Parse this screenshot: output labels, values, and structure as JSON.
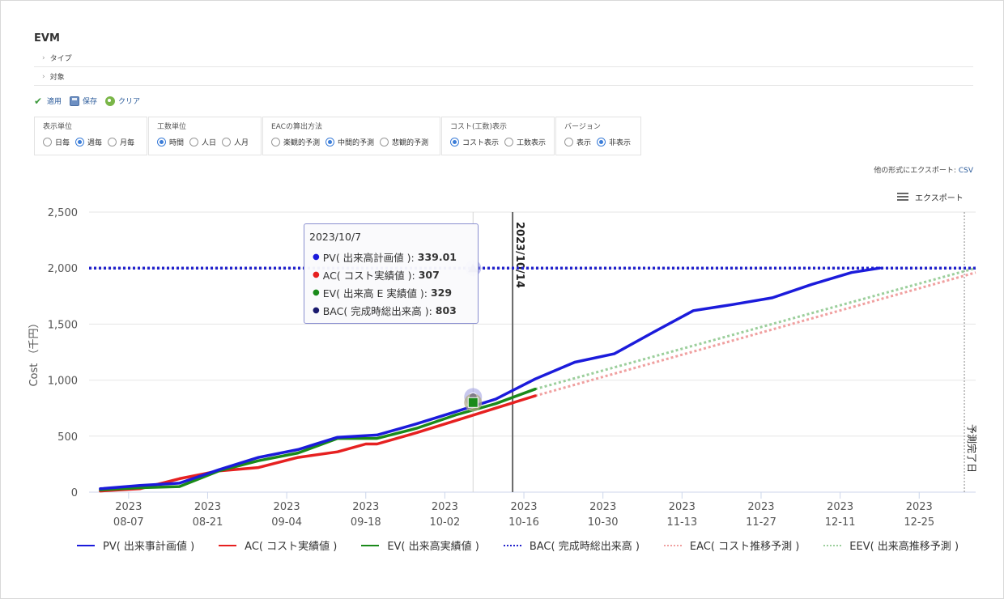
{
  "app": {
    "title": "EVM"
  },
  "sections": [
    {
      "label": "タイプ"
    },
    {
      "label": "対象"
    }
  ],
  "toolbar": {
    "apply_label": "適用",
    "save_label": "保存",
    "clear_label": "クリア"
  },
  "options": {
    "display_unit": {
      "label": "表示単位",
      "choices": [
        "日毎",
        "週毎",
        "月毎"
      ],
      "selected": "週毎"
    },
    "work_unit": {
      "label": "工数単位",
      "choices": [
        "時間",
        "人日",
        "人月"
      ],
      "selected": "時間"
    },
    "eac_method": {
      "label": "EACの算出方法",
      "choices": [
        "楽観的予測",
        "中間的予測",
        "悲観的予測"
      ],
      "selected": "中間的予測"
    },
    "cost_display": {
      "label": "コスト(工数)表示",
      "choices": [
        "コスト表示",
        "工数表示"
      ],
      "selected": "コスト表示"
    },
    "version": {
      "label": "バージョン",
      "choices": [
        "表示",
        "非表示"
      ],
      "selected": "非表示"
    }
  },
  "export": {
    "other_formats_label": "他の形式にエクスポート:",
    "csv_label": "CSV",
    "menu_label": "エクスポート"
  },
  "tooltip": {
    "date": "2023/10/7",
    "rows": [
      {
        "label": "PV( 出来高計画値 ):",
        "value": "339.01",
        "color": "#1b1bdb"
      },
      {
        "label": "AC( コスト実績値 ):",
        "value": "307",
        "color": "#e62020"
      },
      {
        "label": "EV( 出来高 E 実績値 ):",
        "value": "329",
        "color": "#1a8a1a"
      },
      {
        "label": "BAC( 完成時総出来高 ):",
        "value": "803",
        "color": "#1a1a6e"
      }
    ]
  },
  "chart_data": {
    "type": "line",
    "ylabel": "Cost （千円）",
    "ylim": [
      0,
      2500
    ],
    "yticks": [
      0,
      500,
      1000,
      1500,
      2000,
      2500
    ],
    "ytick_labels": [
      "0",
      "500",
      "1,000",
      "1,500",
      "2,000",
      "2,500"
    ],
    "xlim": [
      "2023-07-31",
      "2024-01-04"
    ],
    "xticks": [
      {
        "date": "2023-08-07",
        "label": [
          "2023",
          "08-07"
        ]
      },
      {
        "date": "2023-08-21",
        "label": [
          "2023",
          "08-21"
        ]
      },
      {
        "date": "2023-09-04",
        "label": [
          "2023",
          "09-04"
        ]
      },
      {
        "date": "2023-09-18",
        "label": [
          "2023",
          "09-18"
        ]
      },
      {
        "date": "2023-10-02",
        "label": [
          "2023",
          "10-02"
        ]
      },
      {
        "date": "2023-10-16",
        "label": [
          "2023",
          "10-16"
        ]
      },
      {
        "date": "2023-10-30",
        "label": [
          "2023",
          "10-30"
        ]
      },
      {
        "date": "2023-11-13",
        "label": [
          "2023",
          "11-13"
        ]
      },
      {
        "date": "2023-11-27",
        "label": [
          "2023",
          "11-27"
        ]
      },
      {
        "date": "2023-12-11",
        "label": [
          "2023",
          "12-11"
        ]
      },
      {
        "date": "2023-12-25",
        "label": [
          "2023",
          "12-25"
        ]
      }
    ],
    "grid": true,
    "legend_position": "bottom",
    "plot_lines": [
      {
        "date": "2023-10-14",
        "label": "2023/10/14",
        "color": "#666666"
      },
      {
        "date": "2024-01-02",
        "label": "予測完了日",
        "color": "#888888"
      }
    ],
    "hover_date": "2023-10-07",
    "series": [
      {
        "name": "PV( 出来事計画値 )",
        "color": "#1b1bdb",
        "style": "solid",
        "points": [
          [
            "2023-08-02",
            30
          ],
          [
            "2023-08-09",
            60
          ],
          [
            "2023-08-16",
            80
          ],
          [
            "2023-08-23",
            200
          ],
          [
            "2023-08-30",
            310
          ],
          [
            "2023-09-06",
            380
          ],
          [
            "2023-09-13",
            490
          ],
          [
            "2023-09-20",
            510
          ],
          [
            "2023-09-27",
            610
          ],
          [
            "2023-10-04",
            720
          ],
          [
            "2023-10-11",
            830
          ],
          [
            "2023-10-18",
            1010
          ],
          [
            "2023-10-25",
            1160
          ],
          [
            "2023-11-01",
            1235
          ],
          [
            "2023-11-08",
            1430
          ],
          [
            "2023-11-15",
            1620
          ],
          [
            "2023-11-22",
            1675
          ],
          [
            "2023-11-29",
            1735
          ],
          [
            "2023-12-06",
            1855
          ],
          [
            "2023-12-13",
            1960
          ],
          [
            "2023-12-18",
            2000
          ]
        ]
      },
      {
        "name": "AC( コスト実績値 )",
        "color": "#e62020",
        "style": "solid",
        "points": [
          [
            "2023-08-02",
            10
          ],
          [
            "2023-08-09",
            30
          ],
          [
            "2023-08-16",
            120
          ],
          [
            "2023-08-23",
            190
          ],
          [
            "2023-08-30",
            220
          ],
          [
            "2023-09-06",
            310
          ],
          [
            "2023-09-13",
            360
          ],
          [
            "2023-09-18",
            430
          ],
          [
            "2023-09-20",
            430
          ],
          [
            "2023-09-27",
            530
          ],
          [
            "2023-10-04",
            640
          ],
          [
            "2023-10-11",
            750
          ],
          [
            "2023-10-18",
            860
          ]
        ]
      },
      {
        "name": "EV( 出来高実績値 )",
        "color": "#1a8a1a",
        "style": "solid",
        "points": [
          [
            "2023-08-02",
            20
          ],
          [
            "2023-08-09",
            40
          ],
          [
            "2023-08-16",
            50
          ],
          [
            "2023-08-23",
            190
          ],
          [
            "2023-08-30",
            280
          ],
          [
            "2023-09-06",
            350
          ],
          [
            "2023-09-13",
            480
          ],
          [
            "2023-09-20",
            480
          ],
          [
            "2023-09-27",
            570
          ],
          [
            "2023-10-04",
            690
          ],
          [
            "2023-10-11",
            790
          ],
          [
            "2023-10-18",
            920
          ]
        ]
      },
      {
        "name": "BAC( 完成時総出来高 )",
        "color": "#2222cc",
        "style": "dotted",
        "points": [
          [
            "2023-07-31",
            2000
          ],
          [
            "2024-01-04",
            2000
          ]
        ]
      },
      {
        "name": "EAC( コスト推移予測 )",
        "color": "#f0a0a0",
        "style": "dotted",
        "points": [
          [
            "2023-10-18",
            860
          ],
          [
            "2024-01-04",
            1960
          ]
        ]
      },
      {
        "name": "EEV( 出来高推移予測 )",
        "color": "#9ccf9c",
        "style": "dotted",
        "points": [
          [
            "2023-10-18",
            920
          ],
          [
            "2024-01-04",
            2000
          ]
        ]
      }
    ],
    "markers": [
      {
        "series": "BAC( 完成時総出来高 )",
        "date": "2023-10-07",
        "value": 2000,
        "shape": "triangle",
        "color": "#1a1a8e"
      },
      {
        "series": "PV( 出来事計画値 )",
        "date": "2023-10-07",
        "value": 850,
        "shape": "circle",
        "color": "#1a1a8e"
      },
      {
        "series": "AC( コスト実績値 )",
        "date": "2023-10-07",
        "value": 800,
        "shape": "circle",
        "color": "#e62020"
      },
      {
        "series": "EV( 出来高実績値 )",
        "date": "2023-10-07",
        "value": 800,
        "shape": "square",
        "color": "#1a8a1a"
      }
    ]
  }
}
